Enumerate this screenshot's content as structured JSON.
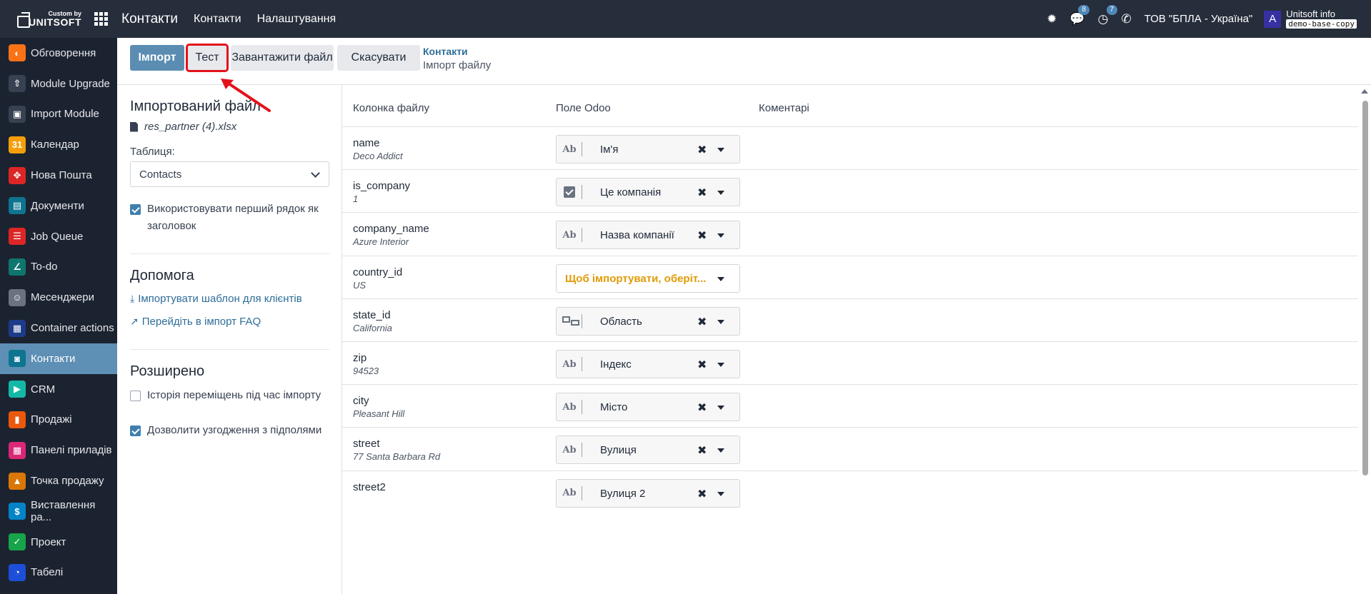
{
  "topbar": {
    "brand_small": "Custom by",
    "brand_big": "UNITSOFT",
    "app_name": "Контакти",
    "menu": [
      "Контакти",
      "Налаштування"
    ],
    "messages_count": "8",
    "activities_count": "7",
    "company": "ТОВ \"БПЛА - Україна\"",
    "avatar_letter": "A",
    "user_name": "Unitsoft info",
    "db_name": "demo-base-copy"
  },
  "sidebar": {
    "items": [
      {
        "label": "Обговорення",
        "icon": "discuss-icon",
        "color": "#f97316"
      },
      {
        "label": "Module Upgrade",
        "icon": "upgrade-icon",
        "color": "#374151"
      },
      {
        "label": "Import Module",
        "icon": "import-module-icon",
        "color": "#374151"
      },
      {
        "label": "Календар",
        "icon": "calendar-icon",
        "color": "#f59e0b"
      },
      {
        "label": "Нова Пошта",
        "icon": "nova-poshta-icon",
        "color": "#dc2626"
      },
      {
        "label": "Документи",
        "icon": "documents-icon",
        "color": "#0e7490"
      },
      {
        "label": "Job Queue",
        "icon": "job-queue-icon",
        "color": "#dc2626"
      },
      {
        "label": "To-do",
        "icon": "todo-icon",
        "color": "#0f766e"
      },
      {
        "label": "Месенджери",
        "icon": "messengers-icon",
        "color": "#6b7280"
      },
      {
        "label": "Container actions",
        "icon": "container-actions-icon",
        "color": "#1e3a8a"
      },
      {
        "label": "Контакти",
        "icon": "contacts-icon",
        "color": "#0e7490"
      },
      {
        "label": "CRM",
        "icon": "crm-icon",
        "color": "#14b8a6"
      },
      {
        "label": "Продажі",
        "icon": "sales-icon",
        "color": "#ea580c"
      },
      {
        "label": "Панелі приладів",
        "icon": "dashboards-icon",
        "color": "#db2777"
      },
      {
        "label": "Точка продажу",
        "icon": "pos-icon",
        "color": "#d97706"
      },
      {
        "label": "Виставлення ра...",
        "icon": "invoicing-icon",
        "color": "#0284c7"
      },
      {
        "label": "Проект",
        "icon": "project-icon",
        "color": "#16a34a"
      },
      {
        "label": "Табелі",
        "icon": "timesheets-icon",
        "color": "#1d4ed8"
      }
    ],
    "active_index": 10
  },
  "control": {
    "import_label": "Імпорт",
    "test_label": "Тест",
    "upload_label": "Завантажити файл",
    "cancel_label": "Скасувати",
    "breadcrumb_parent": "Контакти",
    "breadcrumb_current": "Імпорт файлу"
  },
  "left": {
    "imported_file_title": "Імпортований файл",
    "file_name": "res_partner (4).xlsx",
    "table_label": "Таблиця:",
    "table_value": "Contacts",
    "first_row_header": "Використовувати перший рядок як заголовок",
    "help_title": "Допомога",
    "help_template": "Імпортувати шаблон для клієнтів",
    "help_faq": "Перейдіть в імпорт FAQ",
    "advanced_title": "Розширено",
    "track_history": "Історія переміщень під час імпорту",
    "allow_matching": "Дозволити узгодження з підполями"
  },
  "table": {
    "headers": [
      "Колонка файлу",
      "Поле Odoo",
      "Коментарі"
    ],
    "rows": [
      {
        "column": "name",
        "sample": "Deco Addict",
        "field": "Ім'я",
        "type": "text",
        "type_label": "Ab",
        "warn": false
      },
      {
        "column": "is_company",
        "sample": "1",
        "field": "Це компанія",
        "type": "boolean",
        "type_label": "",
        "warn": false
      },
      {
        "column": "company_name",
        "sample": "Azure Interior",
        "field": "Назва компанії",
        "type": "text",
        "type_label": "Ab",
        "warn": false
      },
      {
        "column": "country_id",
        "sample": "US",
        "field": "Щоб імпортувати, оберіт...",
        "type": "none",
        "type_label": "",
        "warn": true
      },
      {
        "column": "state_id",
        "sample": "California",
        "field": "Область",
        "type": "relation",
        "type_label": "",
        "warn": false
      },
      {
        "column": "zip",
        "sample": "94523",
        "field": "Індекс",
        "type": "text",
        "type_label": "Ab",
        "warn": false
      },
      {
        "column": "city",
        "sample": "Pleasant Hill",
        "field": "Місто",
        "type": "text",
        "type_label": "Ab",
        "warn": false
      },
      {
        "column": "street",
        "sample": "77 Santa Barbara Rd",
        "field": "Вулиця",
        "type": "text",
        "type_label": "Ab",
        "warn": false
      },
      {
        "column": "street2",
        "sample": "",
        "field": "Вулиця 2",
        "type": "text",
        "type_label": "Ab",
        "warn": false
      }
    ]
  },
  "colors": {
    "navbar": "#262d3b",
    "sidebar": "#1c2330",
    "active": "#5e8fb4",
    "primary": "#5b8db3",
    "link": "#2e6d99",
    "warning": "#e09b06",
    "highlight": "#e3121b"
  }
}
